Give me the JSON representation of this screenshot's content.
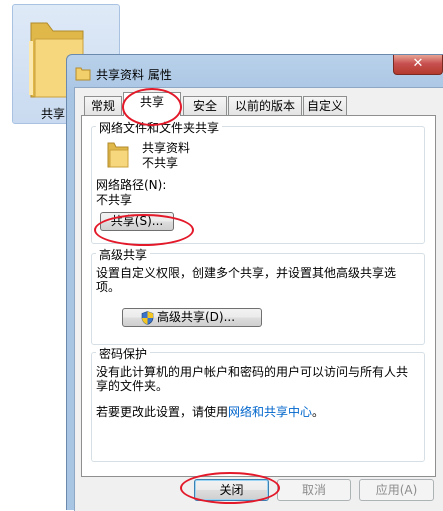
{
  "background": {
    "folder_label": "共享"
  },
  "dialog": {
    "title": "共享资料 属性",
    "close_glyph": "✕",
    "tabs": [
      {
        "label": "常规",
        "active": false
      },
      {
        "label": "共享",
        "active": true
      },
      {
        "label": "安全",
        "active": false
      },
      {
        "label": "以前的版本",
        "active": false
      },
      {
        "label": "自定义",
        "active": false
      }
    ],
    "network_share": {
      "title": "网络文件和文件夹共享",
      "folder_name": "共享资料",
      "status": "不共享",
      "path_label": "网络路径(N):",
      "path_value": "不共享",
      "share_button": "共享(S)..."
    },
    "advanced": {
      "title": "高级共享",
      "description": "设置自定义权限，创建多个共享，并设置其他高级共享选项。",
      "button": "高级共享(D)..."
    },
    "password": {
      "title": "密码保护",
      "description": "没有此计算机的用户帐户和密码的用户可以访问与所有人共享的文件夹。",
      "change_prefix": "若要更改此设置，请使用",
      "change_link": "网络和共享中心",
      "change_suffix": "。"
    },
    "buttons": {
      "close": "关闭",
      "cancel": "取消",
      "apply": "应用(A)"
    }
  },
  "colors": {
    "annotation": "#e3192a",
    "link": "#0066cc",
    "accent": "#a9c5e4"
  }
}
